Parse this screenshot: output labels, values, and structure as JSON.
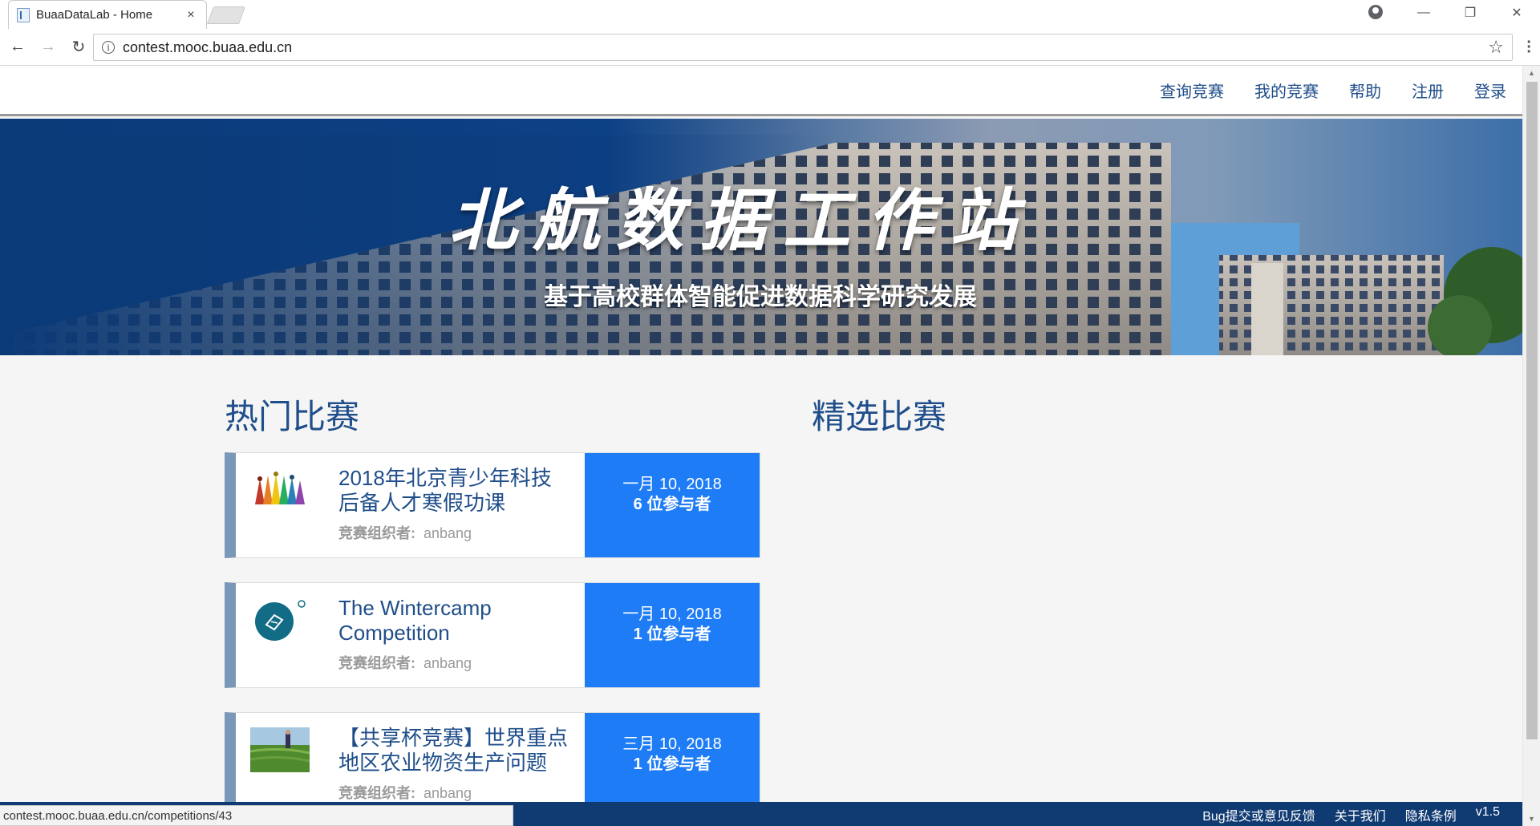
{
  "browser": {
    "tab_title": "BuaaDataLab - Home",
    "tab_close": "×",
    "url": "contest.mooc.buaa.edu.cn",
    "status_url": "contest.mooc.buaa.edu.cn/competitions/43",
    "minimize": "—",
    "restore": "❐",
    "close": "✕"
  },
  "nav": {
    "items": [
      "查询竞赛",
      "我的竞赛",
      "帮助",
      "注册",
      "登录"
    ]
  },
  "hero": {
    "title": "北航数据工作站",
    "subtitle": "基于高校群体智能促进数据科学研究发展"
  },
  "sections": {
    "hot": "热门比赛",
    "featured": "精选比赛"
  },
  "organizer_label": "竞赛组织者:",
  "competitions": [
    {
      "name": "2018年北京青少年科技后备人才寒假功课",
      "organizer": "anbang",
      "date": "一月 10, 2018",
      "participants": "6 位参与者"
    },
    {
      "name": "The Wintercamp Competition",
      "organizer": "anbang",
      "date": "一月 10, 2018",
      "participants": "1 位参与者"
    },
    {
      "name": "【共享杯竞赛】世界重点地区农业物资生产问题",
      "organizer": "anbang",
      "date": "三月 10, 2018",
      "participants": "1 位参与者"
    }
  ],
  "footer": {
    "links": [
      "Bug提交或意见反馈",
      "关于我们",
      "隐私条例",
      "v1.5"
    ]
  }
}
